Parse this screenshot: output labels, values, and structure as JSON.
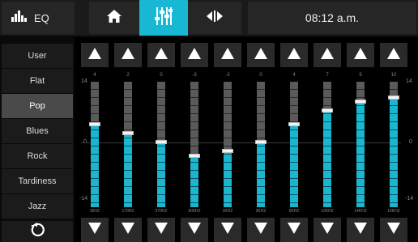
{
  "topbar": {
    "eq_label": "EQ",
    "time": "08:12 a.m.",
    "icons": [
      "eq-bars-icon",
      "home-icon",
      "mixer-sliders-icon",
      "balance-icon"
    ]
  },
  "sidebar": {
    "presets": [
      "User",
      "Flat",
      "Pop",
      "Blues",
      "Rock",
      "Tardiness",
      "Jazz"
    ],
    "active_preset": "Pop",
    "reset_icon": "reset-icon"
  },
  "eq": {
    "scale": {
      "max": "14",
      "zero": "0",
      "min": "-14"
    },
    "bands": [
      {
        "freq": "35HZ",
        "gain": "4",
        "value": 4
      },
      {
        "freq": "170HZ",
        "gain": "2",
        "value": 2
      },
      {
        "freq": "370HZ",
        "gain": "0",
        "value": 0
      },
      {
        "freq": "600HZ",
        "gain": "-3",
        "value": -3
      },
      {
        "freq": "1KHZ",
        "gain": "-2",
        "value": -2
      },
      {
        "freq": "3KHZ",
        "gain": "0",
        "value": 0
      },
      {
        "freq": "6KHZ",
        "gain": "4",
        "value": 4
      },
      {
        "freq": "12KHZ",
        "gain": "7",
        "value": 7
      },
      {
        "freq": "14KHZ",
        "gain": "9",
        "value": 9
      },
      {
        "freq": "16KHZ",
        "gain": "10",
        "value": 10
      }
    ]
  },
  "colors": {
    "accent": "#19b6d0",
    "track": "#5a5a5a",
    "panel": "#1b1b1b"
  }
}
